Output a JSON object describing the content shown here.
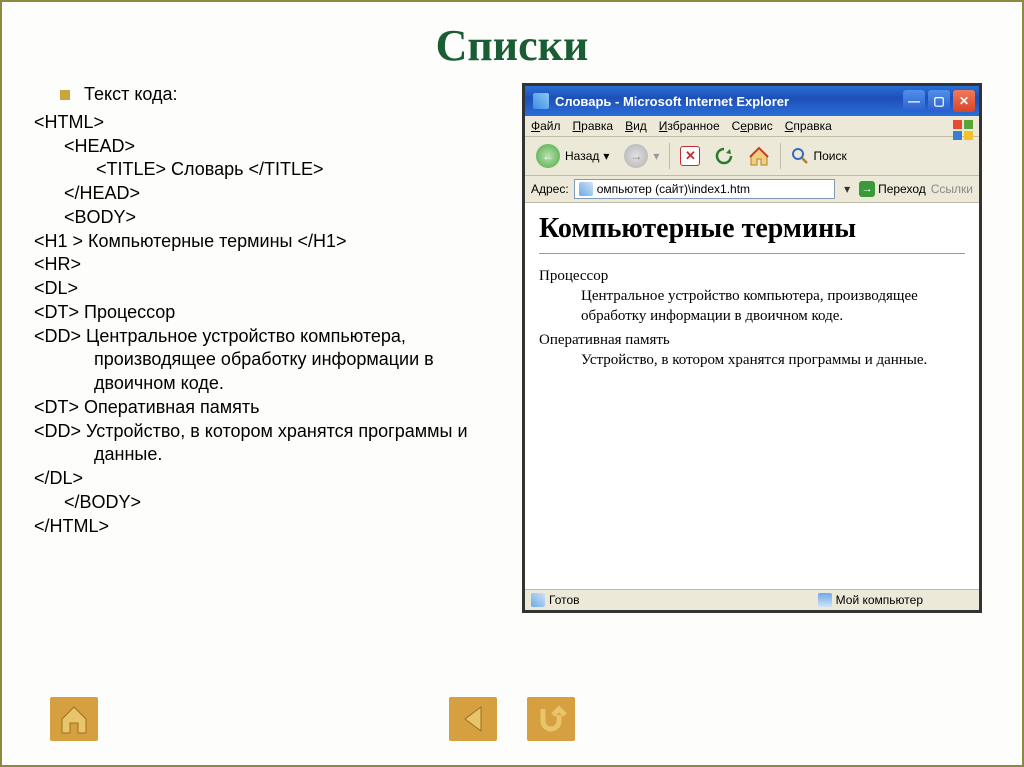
{
  "slide": {
    "title": "Списки",
    "bullet_label": "Текст кода:",
    "code": {
      "l0": "<HTML>",
      "l1": "<HEAD>",
      "l2": "<TITLE> Словарь </TITLE>",
      "l3": "</HEAD>",
      "l4": "<BODY>",
      "l5": "<H1 > Компьютерные термины </H1>",
      "l6": "<HR>",
      "l7": "<DL>",
      "l8": "<DT> Процессор",
      "l9": "<DD> Центральное устройство компьютера, производящее обработку информации в двоичном коде.",
      "l10": "<DT> Оперативная память",
      "l11": "<DD> Устройство, в котором хранятся программы и данные.",
      "l12": "</DL>",
      "l13": "</BODY>",
      "l14": "</HTML>"
    }
  },
  "browser": {
    "title": "Словарь - Microsoft Internet Explorer",
    "menu": {
      "file": "Файл",
      "edit": "Правка",
      "view": "Вид",
      "fav": "Избранное",
      "tools": "Сервис",
      "help": "Справка"
    },
    "toolbar": {
      "back": "Назад",
      "search": "Поиск"
    },
    "addressbar": {
      "label": "Адрес:",
      "path": "омпьютер (сайт)\\index1.htm",
      "go": "Переход",
      "links": "Ссылки"
    },
    "content": {
      "h1": "Компьютерные термины",
      "dt1": "Процессор",
      "dd1": "Центральное устройство компьютера, производящее обработку информации в двоичном коде.",
      "dt2": "Оперативная память",
      "dd2": "Устройство, в котором хранятся программы и данные."
    },
    "status": {
      "ready": "Готов",
      "computer": "Мой компьютер"
    }
  }
}
